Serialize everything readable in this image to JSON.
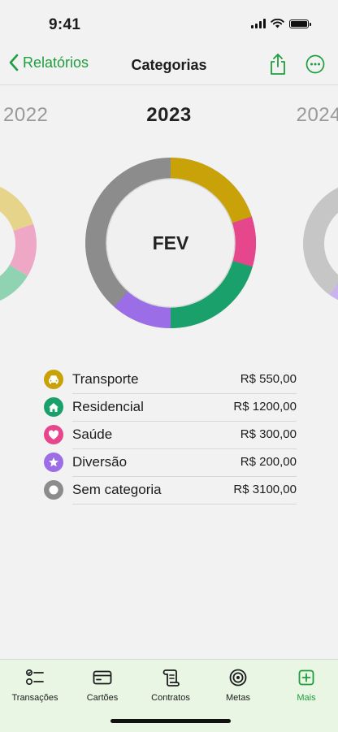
{
  "status": {
    "time": "9:41"
  },
  "nav": {
    "back_label": "Relatórios",
    "title": "Categorias"
  },
  "years": {
    "prev": "2022",
    "current": "2023",
    "next": "2024"
  },
  "month": "FEV",
  "colors": {
    "accent": "#1e9e3e",
    "transporte": "#c9a20a",
    "residencial": "#1aa06b",
    "saude": "#e6468b",
    "diversao": "#9b6ee8",
    "sem_categoria": "#8c8c8c"
  },
  "legend": [
    {
      "name": "Transporte",
      "value": "R$ 550,00",
      "icon": "car-icon"
    },
    {
      "name": "Residencial",
      "value": "R$ 1200,00",
      "icon": "house-icon"
    },
    {
      "name": "Saúde",
      "value": "R$ 300,00",
      "icon": "heart-icon"
    },
    {
      "name": "Diversão",
      "value": "R$ 200,00",
      "icon": "star-icon"
    },
    {
      "name": "Sem categoria",
      "value": "R$ 3100,00",
      "icon": "circle-icon"
    }
  ],
  "tabs": [
    {
      "label": "Transações",
      "icon": "checklist-icon"
    },
    {
      "label": "Cartões",
      "icon": "credit-card-icon"
    },
    {
      "label": "Contratos",
      "icon": "scroll-icon"
    },
    {
      "label": "Metas",
      "icon": "target-icon"
    },
    {
      "label": "Mais",
      "icon": "plus-square-icon",
      "active": true
    }
  ]
}
